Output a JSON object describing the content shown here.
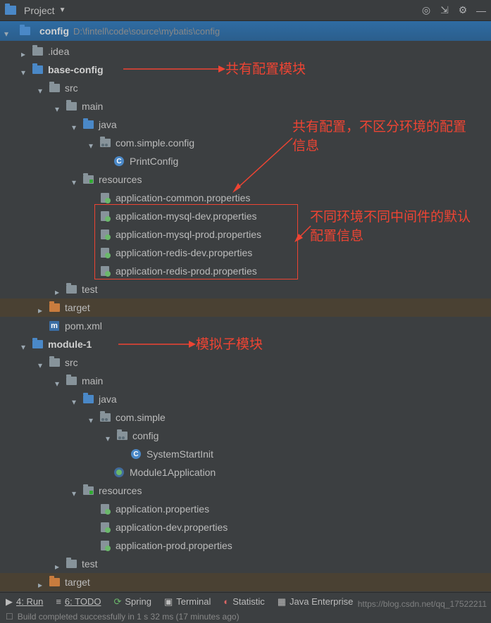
{
  "toolbar": {
    "label": "Project"
  },
  "root": {
    "name": "config",
    "path": "D:\\fintell\\code\\source\\mybatis\\config"
  },
  "tree": {
    "idea": ".idea",
    "base_config": {
      "name": "base-config",
      "src": "src",
      "main": "main",
      "java": "java",
      "pkg": "com.simple.config",
      "print_config": "PrintConfig",
      "resources": "resources",
      "files": {
        "common": "application-common.properties",
        "mysql_dev": "application-mysql-dev.properties",
        "mysql_prod": "application-mysql-prod.properties",
        "redis_dev": "application-redis-dev.properties",
        "redis_prod": "application-redis-prod.properties"
      },
      "test": "test",
      "target": "target",
      "pom": "pom.xml"
    },
    "module1": {
      "name": "module-1",
      "src": "src",
      "main": "main",
      "java": "java",
      "pkg": "com.simple",
      "config_folder": "config",
      "system_start": "SystemStartInit",
      "app_class": "Module1Application",
      "resources": "resources",
      "files": {
        "app": "application.properties",
        "app_dev": "application-dev.properties",
        "app_prod": "application-prod.properties"
      },
      "test": "test",
      "target": "target"
    }
  },
  "annotations": {
    "a1": "共有配置模块",
    "a2": "共有配置，不区分环境的配置信息",
    "a3": "不同环境不同中间件的默认配置信息",
    "a4": "模拟子模块"
  },
  "bottom": {
    "run": "4: Run",
    "todo": "6: TODO",
    "spring": "Spring",
    "terminal": "Terminal",
    "statistic": "Statistic",
    "java_ee": "Java Enterprise"
  },
  "status": "Build completed successfully in 1 s 32 ms (17 minutes ago)",
  "watermark": "https://blog.csdn.net/qq_17522211"
}
